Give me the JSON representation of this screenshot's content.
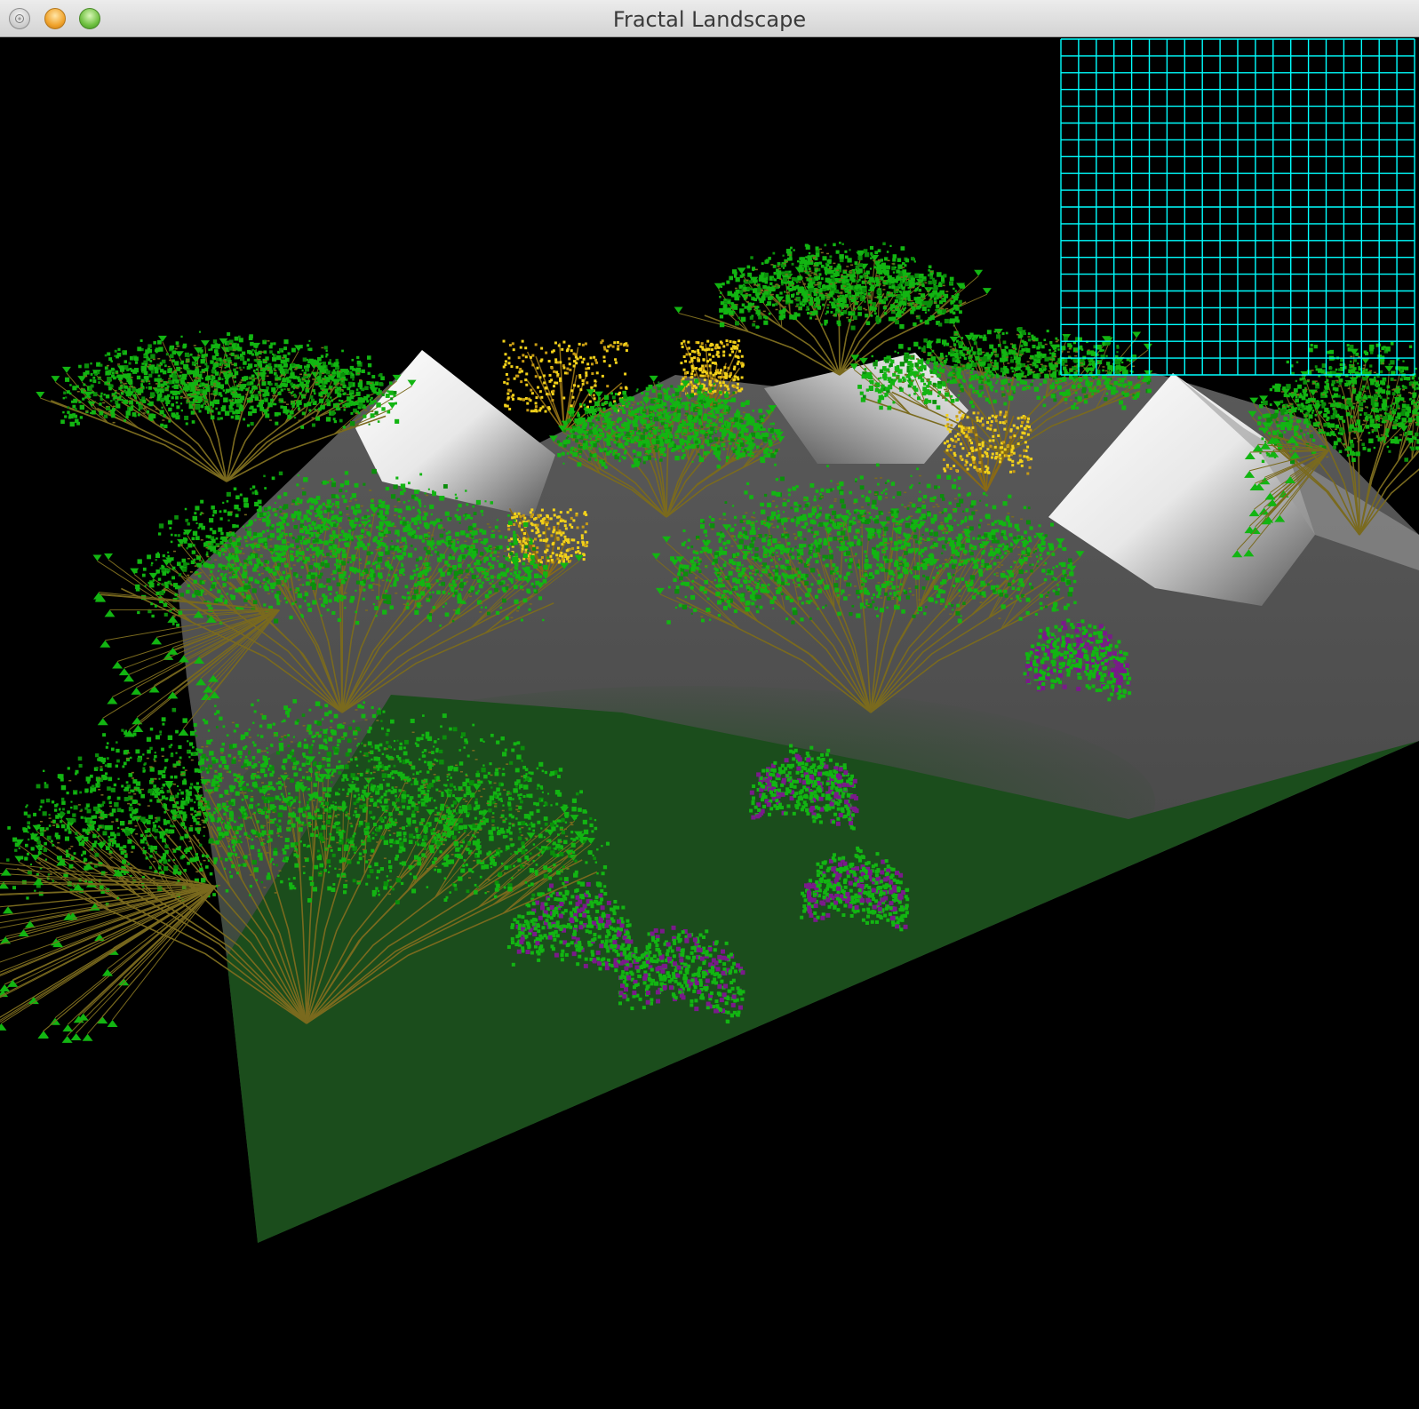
{
  "window": {
    "title": "Fractal Landscape"
  },
  "scene": {
    "background_color": "#000000",
    "grid_color": "#00ffff",
    "grid_rows": 20,
    "grid_cols": 20,
    "terrain_color": "#585858",
    "ground_color": "#1b4d1c",
    "snow_color": "#ffffff",
    "canopy_color": "#12b512",
    "canopy_dark": "#0b8e0b",
    "branch_color": "#7a6a1e",
    "fruit_color": "#7a1a8a",
    "bloom_color": "#f2d11a"
  },
  "icons": [
    "close-icon",
    "minimize-icon",
    "zoom-icon"
  ]
}
